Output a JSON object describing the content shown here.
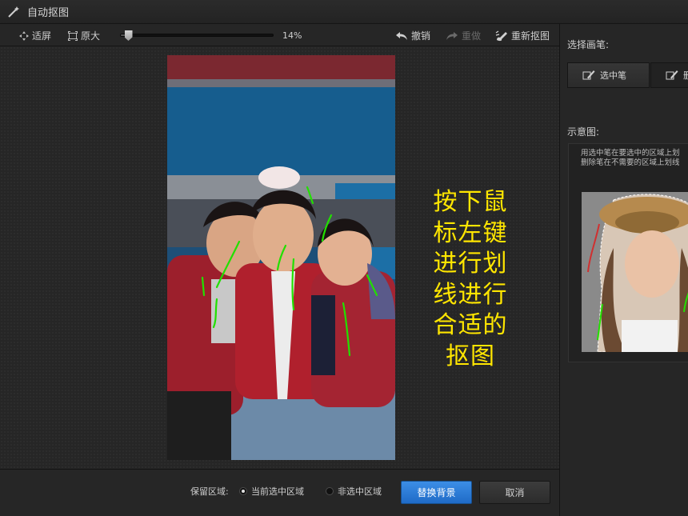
{
  "window": {
    "title": "自动抠图"
  },
  "toolbar": {
    "fit_label": "适屏",
    "original_label": "原大",
    "zoom_value": "14%",
    "zoom_fraction": 0.05,
    "undo_label": "撤销",
    "redo_label": "重做",
    "reset_label": "重新抠图"
  },
  "canvas": {
    "instruction_lines": [
      "按下鼠",
      "标左键",
      "进行划",
      "线进行",
      "合适的",
      "抠图"
    ]
  },
  "bottom": {
    "keep_label": "保留区域:",
    "options": [
      {
        "label": "当前选中区域",
        "selected": true
      },
      {
        "label": "非选中区域",
        "selected": false
      }
    ],
    "replace_label": "替换背景",
    "cancel_label": "取消"
  },
  "panel": {
    "brush_label": "选择画笔:",
    "brush_select_label": "选中笔",
    "brush_delete_label": "删",
    "example_label": "示意图:",
    "example_lines": [
      "用选中笔在要选中的区域上划",
      "删除笔在不需要的区域上划线"
    ]
  },
  "colors": {
    "accent": "#2a7fd8",
    "overlay_text": "#ffe600",
    "stroke_green": "#22e000"
  }
}
